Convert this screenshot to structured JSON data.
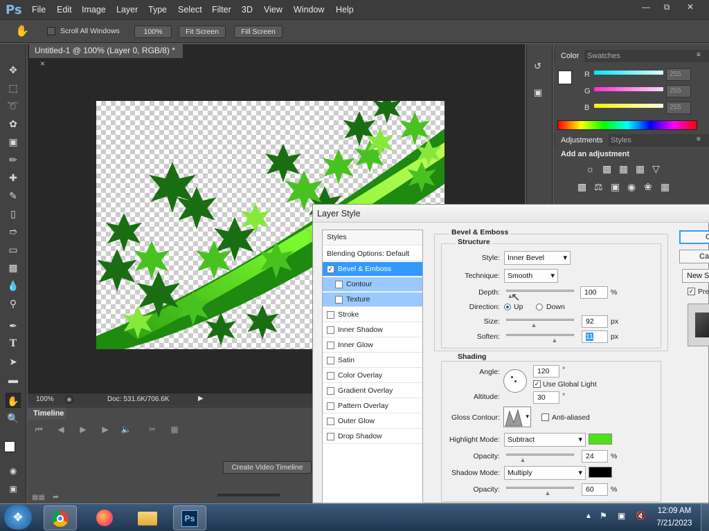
{
  "app": {
    "logo": "Ps"
  },
  "menu": [
    "File",
    "Edit",
    "Image",
    "Layer",
    "Type",
    "Select",
    "Filter",
    "3D",
    "View",
    "Window",
    "Help"
  ],
  "window_controls": {
    "minimize": "—",
    "restore": "⧉",
    "close": "✕"
  },
  "options_bar": {
    "hand_icon": "hand-icon",
    "scroll_all_label": "Scroll All Windows",
    "zoom_btn": "100%",
    "fit_btn": "Fit Screen",
    "fill_btn": "Fill Screen"
  },
  "document": {
    "tab_title": "Untitled-1 @ 100% (Layer 0, RGB/8) *",
    "tab_close": "×"
  },
  "status": {
    "zoom": "100%",
    "doc": "Doc: 531.6K/706.6K"
  },
  "timeline": {
    "tab": "Timeline",
    "create_btn": "Create Video Timeline"
  },
  "color_panel": {
    "tabs": [
      "Color",
      "Swatches"
    ],
    "channels": [
      {
        "label": "R",
        "value": "255",
        "color": "#00e5ff"
      },
      {
        "label": "G",
        "value": "255",
        "color": "#ff2bd6"
      },
      {
        "label": "B",
        "value": "255",
        "color": "#ffee00"
      }
    ]
  },
  "adjustments_panel": {
    "tabs": [
      "Adjustments",
      "Styles"
    ],
    "heading": "Add an adjustment"
  },
  "dialog": {
    "title": "Layer Style",
    "styles_header": "Styles",
    "blending": "Blending Options: Default",
    "list": [
      {
        "label": "Bevel & Emboss",
        "checked": true,
        "state": "selected"
      },
      {
        "label": "Contour",
        "checked": false,
        "state": "sub"
      },
      {
        "label": "Texture",
        "checked": false,
        "state": "sub"
      },
      {
        "label": "Stroke",
        "checked": false
      },
      {
        "label": "Inner Shadow",
        "checked": false
      },
      {
        "label": "Inner Glow",
        "checked": false
      },
      {
        "label": "Satin",
        "checked": false
      },
      {
        "label": "Color Overlay",
        "checked": false
      },
      {
        "label": "Gradient Overlay",
        "checked": false
      },
      {
        "label": "Pattern Overlay",
        "checked": false
      },
      {
        "label": "Outer Glow",
        "checked": false
      },
      {
        "label": "Drop Shadow",
        "checked": false
      }
    ],
    "bevel": {
      "section": "Bevel & Emboss",
      "structure": "Structure",
      "style_label": "Style:",
      "style_value": "Inner Bevel",
      "technique_label": "Technique:",
      "technique_value": "Smooth",
      "depth_label": "Depth:",
      "depth_value": "100",
      "depth_unit": "%",
      "direction_label": "Direction:",
      "dir_up": "Up",
      "dir_down": "Down",
      "size_label": "Size:",
      "size_value": "92",
      "size_unit": "px",
      "soften_label": "Soften:",
      "soften_value": "11",
      "soften_unit": "px"
    },
    "shading": {
      "section": "Shading",
      "angle_label": "Angle:",
      "angle_value": "120",
      "deg": "°",
      "global_light": "Use Global Light",
      "altitude_label": "Altitude:",
      "altitude_value": "30",
      "gloss_label": "Gloss Contour:",
      "anti_aliased": "Anti-aliased",
      "highlight_label": "Highlight Mode:",
      "highlight_value": "Subtract",
      "highlight_color": "#4ee01a",
      "hl_opacity_label": "Opacity:",
      "hl_opacity_value": "24",
      "shadow_label": "Shadow Mode:",
      "shadow_value": "Multiply",
      "shadow_color": "#000000",
      "sh_opacity_label": "Opacity:",
      "sh_opacity_value": "60",
      "pct": "%"
    },
    "buttons": {
      "ok": "OK",
      "cancel": "Cancel",
      "new_style": "New Style...",
      "preview": "Preview"
    }
  },
  "taskbar": {
    "time": "12:09 AM",
    "date": "7/21/2023"
  }
}
